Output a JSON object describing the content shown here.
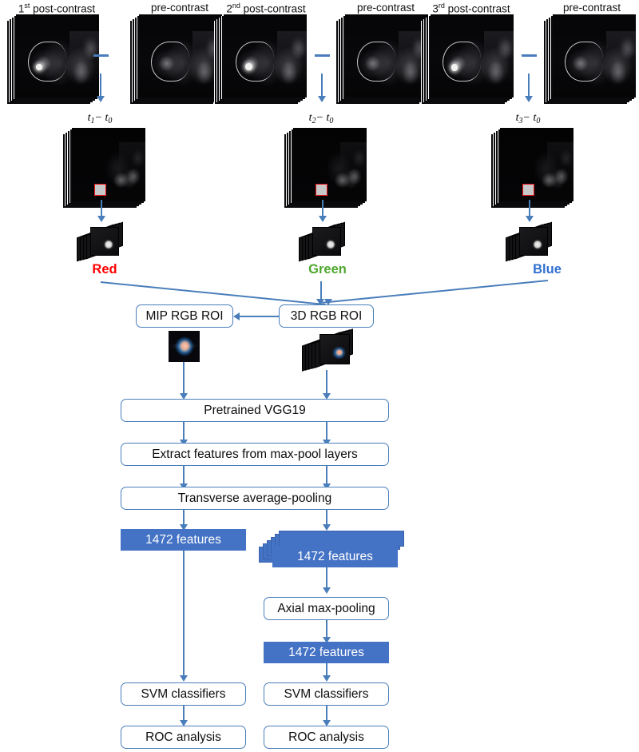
{
  "diagram": {
    "title": "Breast DCE-MRI RGB ROI deep-feature extraction and classification workflow",
    "colors": {
      "accent_blue": "#4a7ebb",
      "fill_blue": "#4472c4",
      "red": "#ff0000",
      "green": "#4ea72e",
      "blue": "#2f6fd0",
      "roi_marker_red": "#e8151a"
    },
    "top_row": {
      "columns": [
        {
          "post_label_prefix": "1",
          "post_label_sup": "st",
          "post_label_rest": " post-contrast",
          "pre_label": "pre-contrast",
          "operator": "minus",
          "result_label_t": "t",
          "result_label_sub": "1",
          "result_label_tail": "− t",
          "result_label_sub0": "0",
          "channel": "Red",
          "channel_color": "#ff0000"
        },
        {
          "post_label_prefix": "2",
          "post_label_sup": "nd",
          "post_label_rest": " post-contrast",
          "pre_label": "pre-contrast",
          "operator": "minus",
          "result_label_t": "t",
          "result_label_sub": "2",
          "result_label_tail": "− t",
          "result_label_sub0": "0",
          "channel": "Green",
          "channel_color": "#4ea72e"
        },
        {
          "post_label_prefix": "3",
          "post_label_sup": "rd",
          "post_label_rest": " post-contrast",
          "pre_label": "pre-contrast",
          "operator": "minus",
          "result_label_t": "t",
          "result_label_sub": "3",
          "result_label_tail": "− t",
          "result_label_sub0": "0",
          "channel": "Blue",
          "channel_color": "#2f6fd0"
        }
      ]
    },
    "roi_boxes": {
      "mip": "MIP RGB ROI",
      "three_d": "3D RGB ROI"
    },
    "pipeline": {
      "vgg19": "Pretrained VGG19",
      "extract": "Extract features from max-pool layers",
      "transverse_pool": "Transverse average-pooling",
      "features_left": "1472 features",
      "features_right_stack": "1472 features",
      "axial_pool": "Axial max-pooling",
      "features_right_pooled": "1472 features",
      "svm_left": "SVM classifiers",
      "svm_right": "SVM classifiers",
      "roc_left": "ROC analysis",
      "roc_right": "ROC analysis"
    }
  }
}
